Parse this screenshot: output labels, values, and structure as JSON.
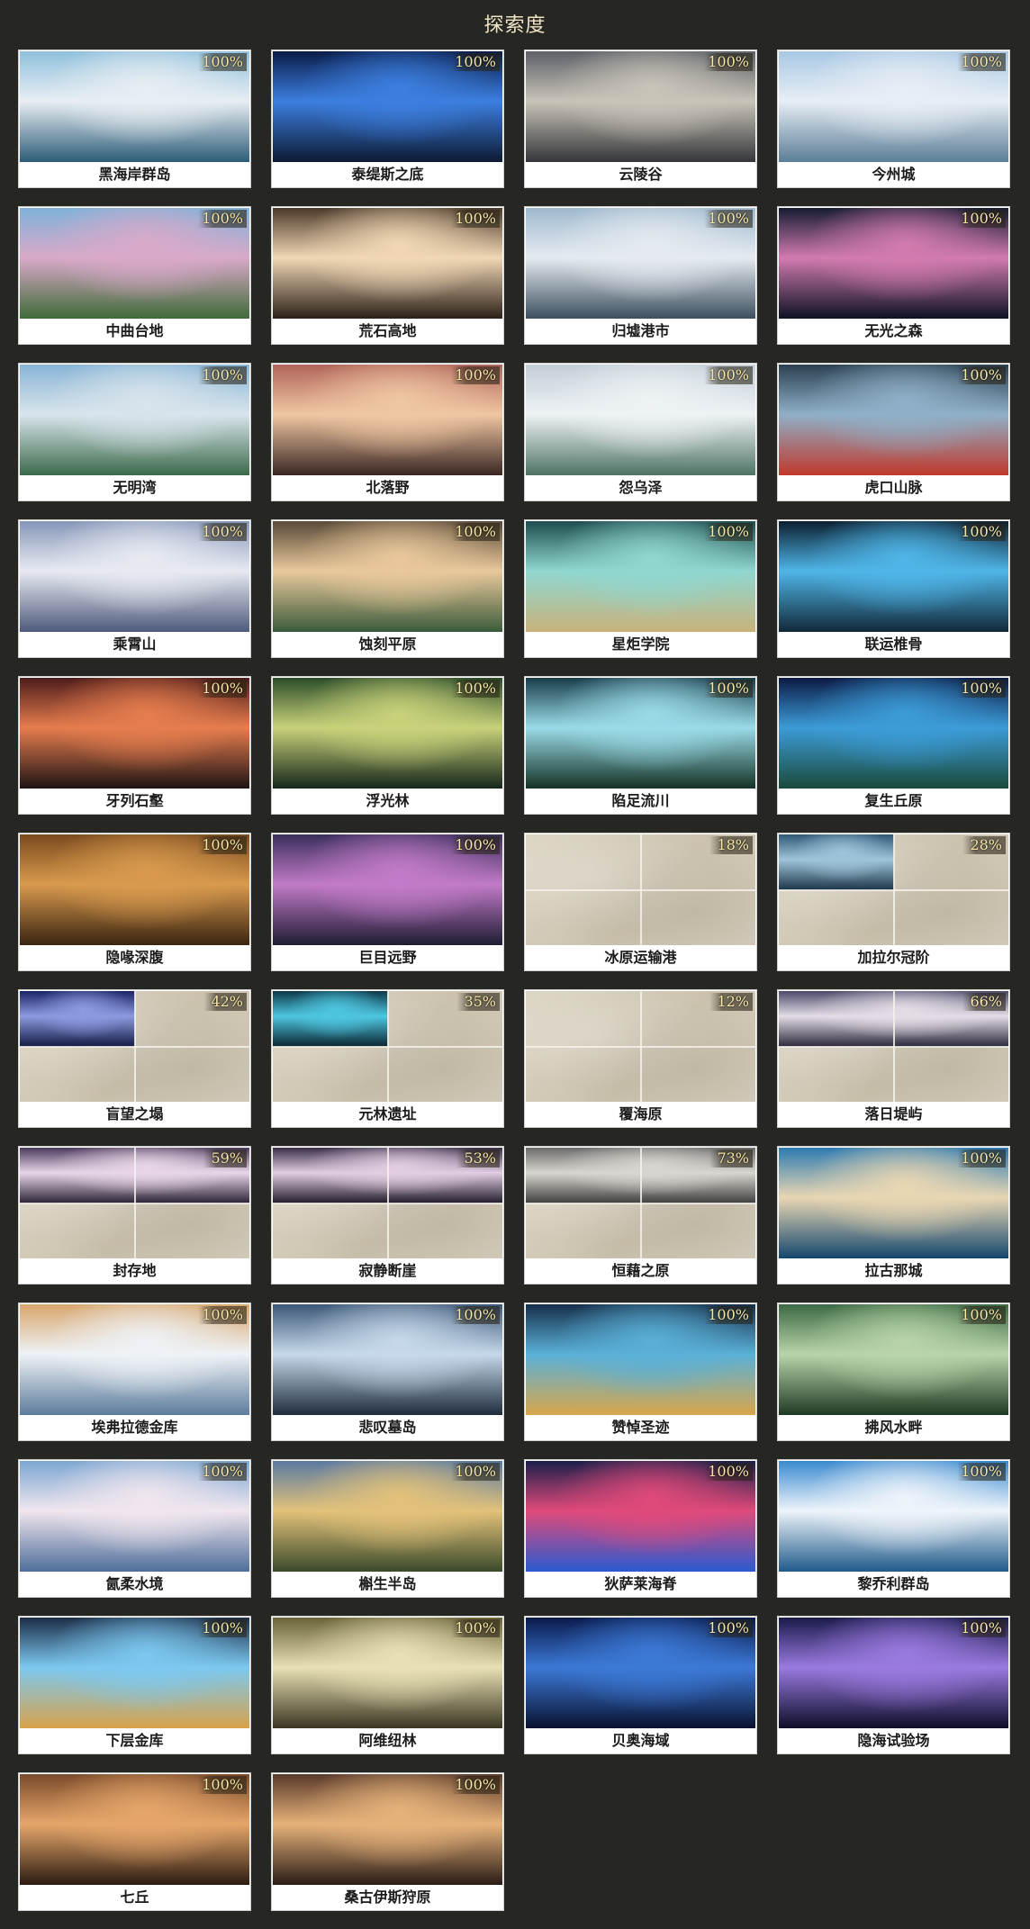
{
  "header": {
    "title": "探索度"
  },
  "regions": [
    {
      "name": "黑海岸群岛",
      "progress": "100%",
      "colors": [
        "#8fc0dc",
        "#e8eef3",
        "#2c5c78"
      ]
    },
    {
      "name": "泰缇斯之底",
      "progress": "100%",
      "colors": [
        "#0a1c48",
        "#3c7fe0",
        "#0d1a33"
      ]
    },
    {
      "name": "云陵谷",
      "progress": "100%",
      "colors": [
        "#5c6068",
        "#c9c4b8",
        "#34363a"
      ]
    },
    {
      "name": "今州城",
      "progress": "100%",
      "colors": [
        "#a9c8e4",
        "#e7eef5",
        "#5b7d97"
      ]
    },
    {
      "name": "中曲台地",
      "progress": "100%",
      "colors": [
        "#7fb2d9",
        "#d9a9c9",
        "#3f6b38"
      ]
    },
    {
      "name": "荒石高地",
      "progress": "100%",
      "colors": [
        "#4d3a2a",
        "#f1d7b5",
        "#2b2018"
      ]
    },
    {
      "name": "归墟港市",
      "progress": "100%",
      "colors": [
        "#9fb9cf",
        "#e5ebf0",
        "#3d4f60"
      ]
    },
    {
      "name": "无光之森",
      "progress": "100%",
      "colors": [
        "#151c33",
        "#d27bb0",
        "#0c1222"
      ]
    },
    {
      "name": "无明湾",
      "progress": "100%",
      "colors": [
        "#89b5d6",
        "#d8e4ec",
        "#3b6b4a"
      ]
    },
    {
      "name": "北落野",
      "progress": "100%",
      "colors": [
        "#b0645a",
        "#f0c7a2",
        "#3a2622"
      ]
    },
    {
      "name": "怨乌泽",
      "progress": "100%",
      "colors": [
        "#c3cfd8",
        "#eef2f4",
        "#4e7465"
      ]
    },
    {
      "name": "虎口山脉",
      "progress": "100%",
      "colors": [
        "#2b4152",
        "#8fb0c8",
        "#c0392b"
      ]
    },
    {
      "name": "乘霄山",
      "progress": "100%",
      "colors": [
        "#8596b8",
        "#e8eaf2",
        "#4d5a7a"
      ]
    },
    {
      "name": "蚀刻平原",
      "progress": "100%",
      "colors": [
        "#5a4a38",
        "#e9c89b",
        "#3a5b3a"
      ]
    },
    {
      "name": "星炬学院",
      "progress": "100%",
      "colors": [
        "#1e4d4e",
        "#8fd7d0",
        "#c9b27a"
      ]
    },
    {
      "name": "联运椎骨",
      "progress": "100%",
      "colors": [
        "#0c1f30",
        "#4fb6e8",
        "#12293a"
      ]
    },
    {
      "name": "牙列石壑",
      "progress": "100%",
      "colors": [
        "#4d1c1a",
        "#e67d4e",
        "#1f1414"
      ]
    },
    {
      "name": "浮光林",
      "progress": "100%",
      "colors": [
        "#2b4d2a",
        "#c9d27a",
        "#15261a"
      ]
    },
    {
      "name": "陷足流川",
      "progress": "100%",
      "colors": [
        "#1a3d4a",
        "#9adbe8",
        "#143224"
      ]
    },
    {
      "name": "复生丘原",
      "progress": "100%",
      "colors": [
        "#0c1a44",
        "#3c9cd8",
        "#1a4a3a"
      ]
    },
    {
      "name": "隐喙深腹",
      "progress": "100%",
      "colors": [
        "#7a4a1e",
        "#d99a4e",
        "#3a2410"
      ]
    },
    {
      "name": "巨目远野",
      "progress": "100%",
      "colors": [
        "#3a2f5c",
        "#c27bc8",
        "#1e1c33"
      ]
    },
    {
      "name": "冰原运输港",
      "progress": "18%",
      "colors": [
        "#d8d0bf",
        "#d8d0bf",
        "#d8d0bf"
      ]
    },
    {
      "name": "加拉尔冠阶",
      "progress": "28%",
      "colors": [
        "#2f5a78",
        "#9fc4da",
        "#1c3548"
      ]
    },
    {
      "name": "盲望之塌",
      "progress": "42%",
      "colors": [
        "#1c2466",
        "#8c9ae0",
        "#141a44"
      ]
    },
    {
      "name": "元林遗址",
      "progress": "35%",
      "colors": [
        "#0d3848",
        "#4ec6e0",
        "#0a2430"
      ]
    },
    {
      "name": "覆海原",
      "progress": "12%",
      "colors": [
        "#d8d0bf",
        "#d8d0bf",
        "#d8d0bf"
      ]
    },
    {
      "name": "落日堤屿",
      "progress": "66%",
      "colors": [
        "#4c4a6a",
        "#e4dde6",
        "#2a283c"
      ]
    },
    {
      "name": "封存地",
      "progress": "59%",
      "colors": [
        "#4a3a5c",
        "#e8d6e8",
        "#2b2236"
      ]
    },
    {
      "name": "寂静断崖",
      "progress": "53%",
      "colors": [
        "#3a2f4a",
        "#e2cde2",
        "#1f1a29"
      ]
    },
    {
      "name": "恒藉之原",
      "progress": "73%",
      "colors": [
        "#6a6a6a",
        "#d8d6d0",
        "#3e3e3e"
      ]
    },
    {
      "name": "拉古那城",
      "progress": "100%",
      "colors": [
        "#2d7ab2",
        "#e9d7b3",
        "#13466e"
      ]
    },
    {
      "name": "埃弗拉德金库",
      "progress": "100%",
      "colors": [
        "#d8a66c",
        "#eef2f6",
        "#5c7c9c"
      ]
    },
    {
      "name": "悲叹墓岛",
      "progress": "100%",
      "colors": [
        "#3c5878",
        "#c6d8ea",
        "#1e2c3c"
      ]
    },
    {
      "name": "赞悼圣迹",
      "progress": "100%",
      "colors": [
        "#16304a",
        "#5ab0d8",
        "#d8a64a"
      ]
    },
    {
      "name": "拂风水畔",
      "progress": "100%",
      "colors": [
        "#3c6a44",
        "#b8d4a8",
        "#1f3a24"
      ]
    },
    {
      "name": "氤柔水境",
      "progress": "100%",
      "colors": [
        "#7ca6d2",
        "#f0e6ee",
        "#4e6e9a"
      ]
    },
    {
      "name": "槲生半岛",
      "progress": "100%",
      "colors": [
        "#5a7aa2",
        "#e3c27a",
        "#3a4a2a"
      ]
    },
    {
      "name": "狄萨莱海脊",
      "progress": "100%",
      "colors": [
        "#1a1f4a",
        "#e04a7a",
        "#2a5ad0"
      ]
    },
    {
      "name": "黎乔利群岛",
      "progress": "100%",
      "colors": [
        "#3a8ad0",
        "#eef4fa",
        "#1f5a8a"
      ]
    },
    {
      "name": "下层金库",
      "progress": "100%",
      "colors": [
        "#1c2e48",
        "#7cc8f0",
        "#d8a24a"
      ]
    },
    {
      "name": "阿维纽林",
      "progress": "100%",
      "colors": [
        "#6a6238",
        "#e9e0b4",
        "#3a3622"
      ]
    },
    {
      "name": "贝奥海域",
      "progress": "100%",
      "colors": [
        "#0a1a4a",
        "#3c7ad8",
        "#0a1230"
      ]
    },
    {
      "name": "隐海试验场",
      "progress": "100%",
      "colors": [
        "#1a1a4a",
        "#9a7ae0",
        "#0e0e2a"
      ]
    },
    {
      "name": "七丘",
      "progress": "100%",
      "colors": [
        "#7a4a2a",
        "#e6a66a",
        "#2c1c12"
      ]
    },
    {
      "name": "桑古伊斯狩原",
      "progress": "100%",
      "colors": [
        "#5a3a2a",
        "#e6b27a",
        "#2a1c16"
      ]
    }
  ]
}
